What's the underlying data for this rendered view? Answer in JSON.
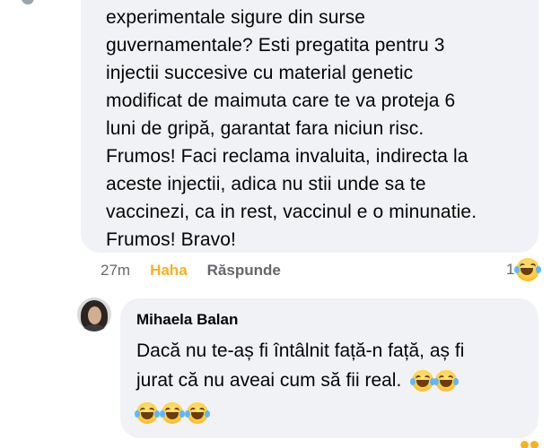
{
  "comment": {
    "lines": [
      "experimentale sigure din surse",
      "guvernamentale? Esti pregatita pentru 3",
      "injectii succesive cu material genetic",
      "modificat de maimuta care te va proteja 6",
      "luni de gripă, garantat fara niciun risc.",
      "Frumos! Faci reclama invaluita, indirecta la",
      "aceste injectii, adica nu stii unde sa te",
      "vaccinezi, ca in rest, vaccinul e o minunatie.",
      "Frumos! Bravo!"
    ],
    "time": "27m",
    "haha_label": "Haha",
    "reply_label": "Răspunde",
    "reaction_count": "1",
    "reaction_icon": "laughing-with-tears-emoji"
  },
  "reply": {
    "author": "Mihaela Balan",
    "line1": "Dacă nu te-aș fi întâlnit față-n față, aș fi",
    "line2": "jurat că nu aveai cum să fii real.",
    "inline_emoji_count": 2,
    "emoji_row_count": 3,
    "emoji_icon": "laughing-with-tears-emoji"
  },
  "colors": {
    "bubble": "#f0f2f5",
    "text": "#050505",
    "muted": "#65676b",
    "haha": "#f7b125"
  }
}
